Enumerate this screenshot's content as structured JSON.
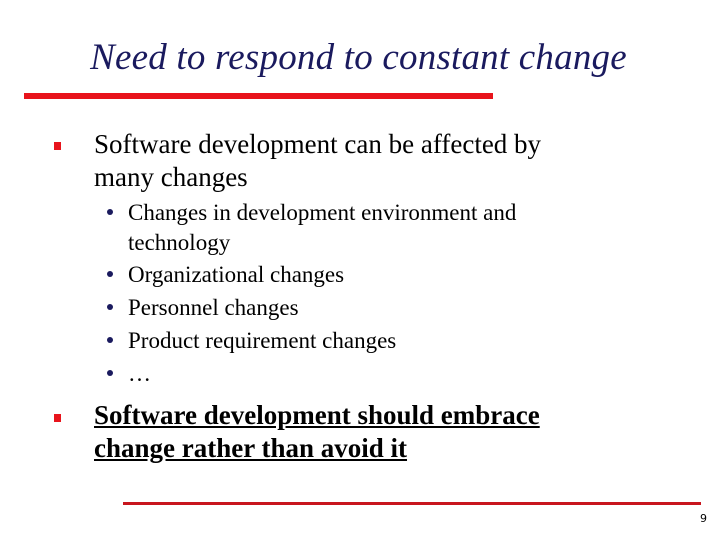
{
  "slide": {
    "title": "Need to respond to constant change",
    "page_number": "9",
    "colors": {
      "title": "#1a1a5e",
      "accent_red": "#e8141c",
      "sub_bullet": "#1a1a5e",
      "text": "#000000"
    },
    "bullets": [
      {
        "lines": [
          "Software development can be affected by",
          "many changes"
        ],
        "style": "normal",
        "sub_bullets": [
          {
            "lines": [
              "Changes in development environment and",
              "technology"
            ]
          },
          {
            "lines": [
              "Organizational changes"
            ]
          },
          {
            "lines": [
              "Personnel changes"
            ]
          },
          {
            "lines": [
              "Product requirement changes"
            ]
          },
          {
            "lines": [
              "…"
            ]
          }
        ]
      },
      {
        "lines": [
          "Software development should embrace",
          "change rather than avoid it"
        ],
        "style": "bold-underline"
      }
    ]
  }
}
